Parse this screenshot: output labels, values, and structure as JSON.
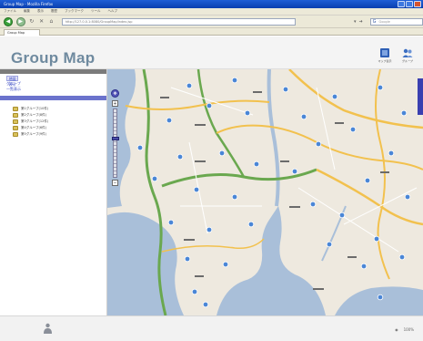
{
  "window": {
    "title": "Group Map - Mozilla Firefox"
  },
  "menubar": {
    "items": [
      "ファイル",
      "編集",
      "表示",
      "履歴",
      "ブックマーク",
      "ツール",
      "ヘルプ"
    ]
  },
  "navbar": {
    "address": "http://127.0.0.1:8080/GroupMap/index.jsp",
    "search_placeholder": "Google"
  },
  "tab": {
    "label": "Group Map"
  },
  "app": {
    "title": "Group Map",
    "tools": [
      {
        "label": "マップ表示",
        "icon": "book-icon"
      },
      {
        "label": "グループ",
        "icon": "people-icon"
      }
    ]
  },
  "sidebar": {
    "links": [
      "地図表示",
      "グループ",
      "一覧表示"
    ],
    "groups": [
      "第1グループ(10件)",
      "第2グループ(8件)",
      "第3グループ(12件)",
      "第4グループ(6件)",
      "第5グループ(9件)"
    ]
  },
  "map": {
    "colors": {
      "water": "#a9bfd9",
      "land": "#eee9df",
      "expressway": "#6aa84f",
      "highway": "#f2c14e",
      "marker": "#4a86d6"
    }
  },
  "bottom": {
    "zoom_text": "100%"
  }
}
